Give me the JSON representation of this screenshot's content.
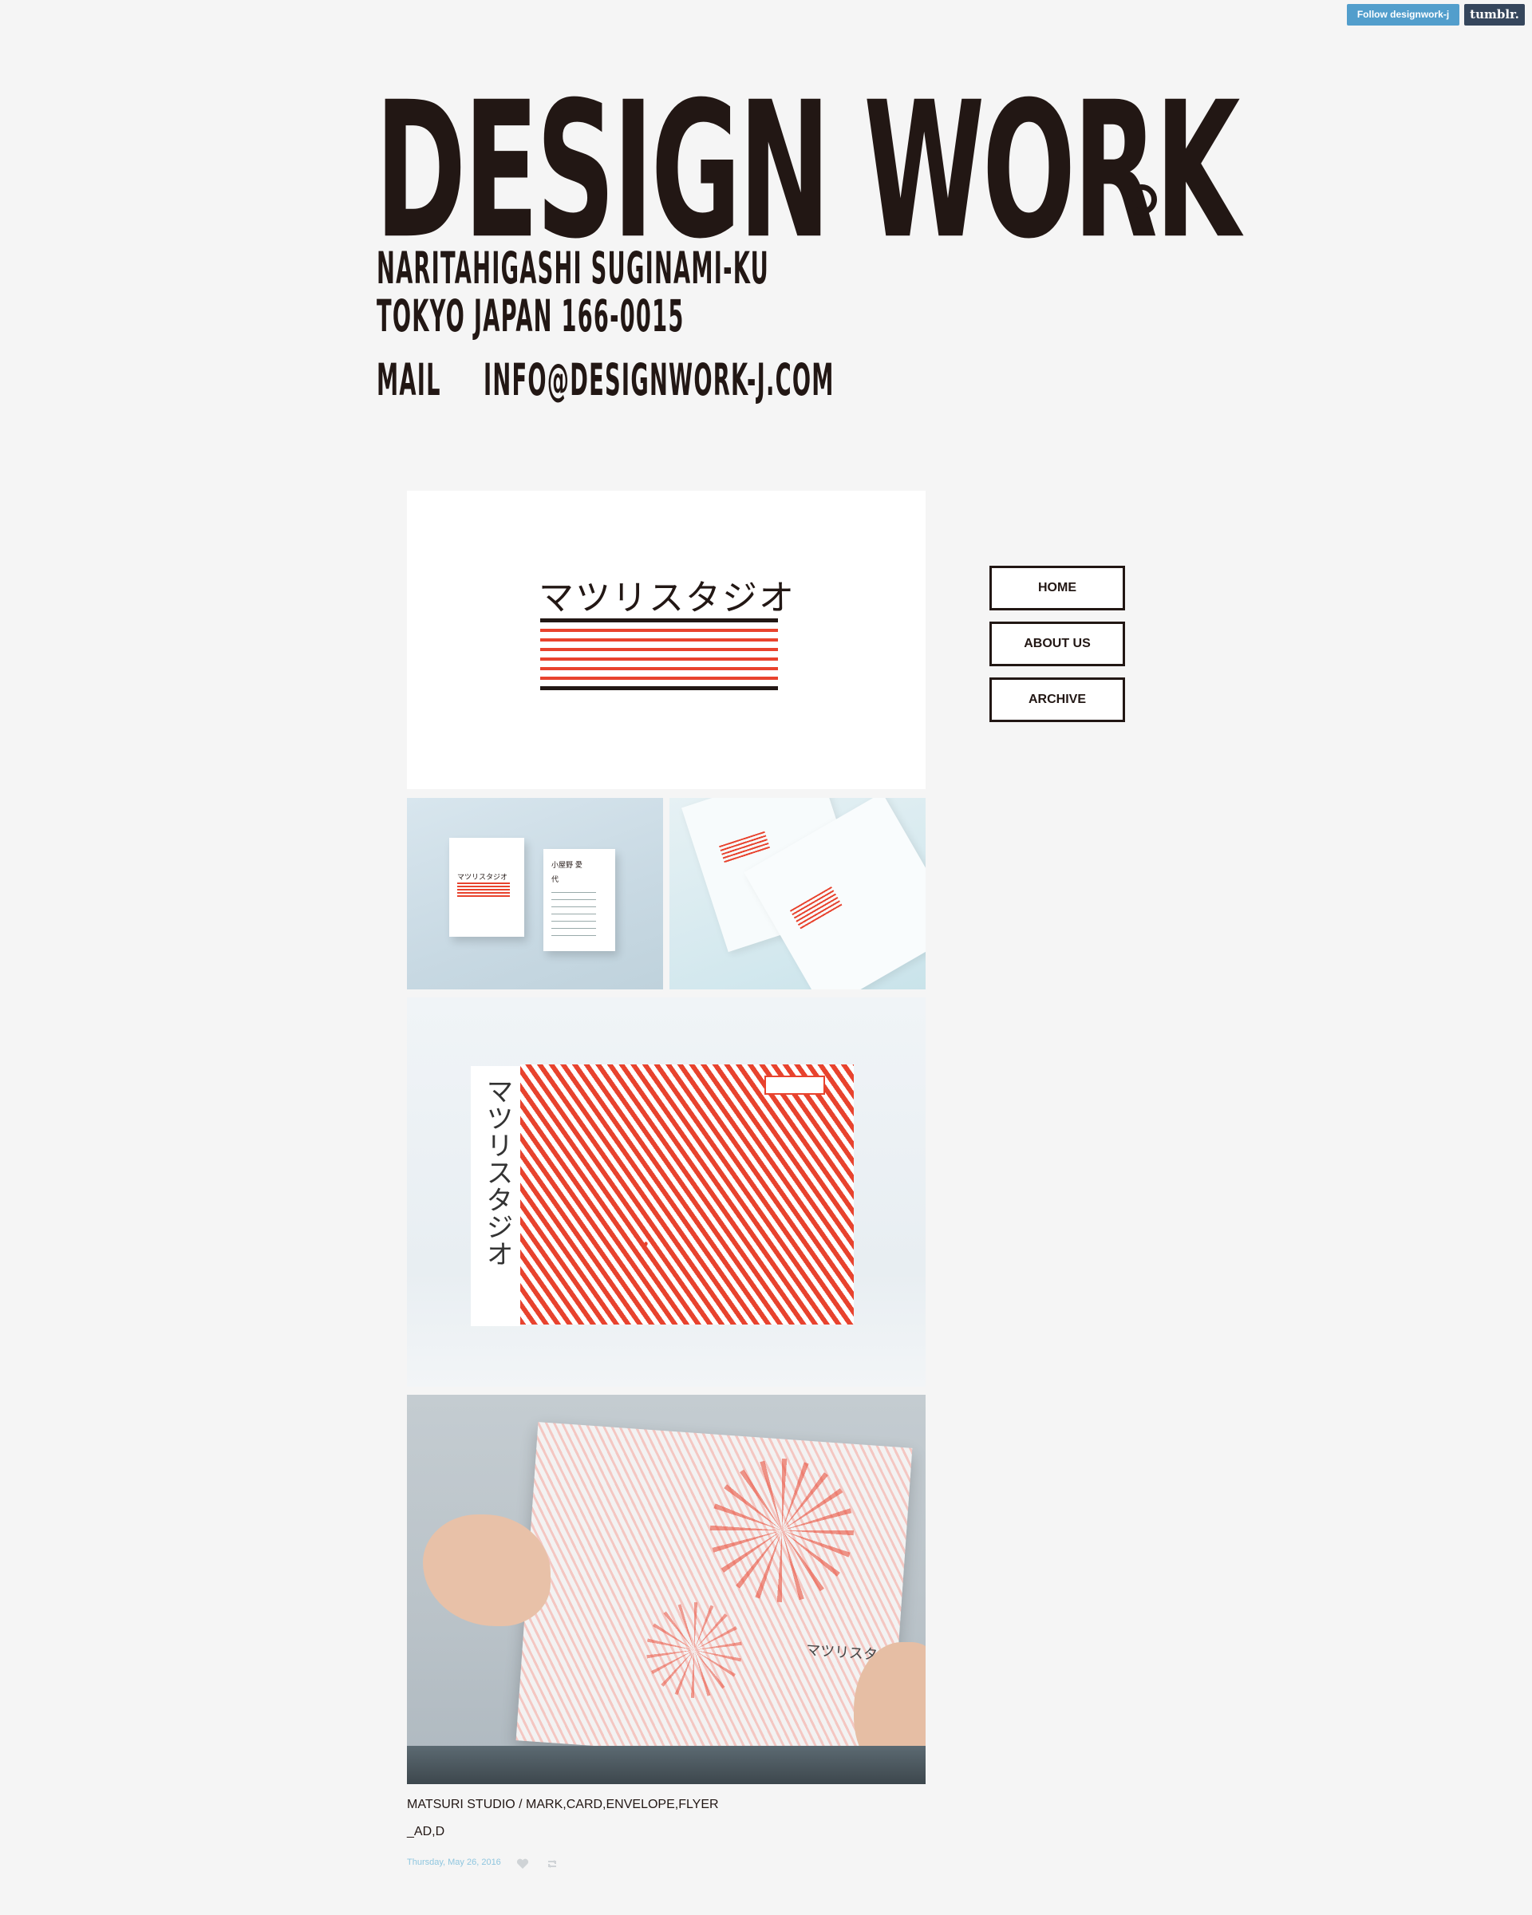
{
  "tumblr_controls": {
    "follow_label": "Follow designwork-j",
    "logo_label": "tumblr."
  },
  "header": {
    "title": "DESIGN WORK",
    "address_line1": "NARITAHIGASHI SUGINAMI-KU",
    "address_line2": "TOKYO JAPAN 166-0015",
    "mail_label": "MAIL",
    "mail_value": "INFO@DESIGNWORK-J.COM"
  },
  "post": {
    "logo_text": "マツリスタジオ",
    "card_name": "小屋野 愛代",
    "envelope_vertical_text": "マツリスタジオ",
    "caption_line1": "MATSURI STUDIO / MARK,CARD,ENVELOPE,FLYER",
    "caption_line2": "_AD,D",
    "date": "Thursday, May 26, 2016"
  },
  "nav": {
    "home": "HOME",
    "about": "ABOUT US",
    "archive": "ARCHIVE"
  },
  "colors": {
    "background": "#f5f5f5",
    "ink": "#221714",
    "accent_red": "#e8432e",
    "follow_blue": "#529ecc",
    "tumblr_navy": "#35465c",
    "date_blue": "#8fc6df"
  }
}
